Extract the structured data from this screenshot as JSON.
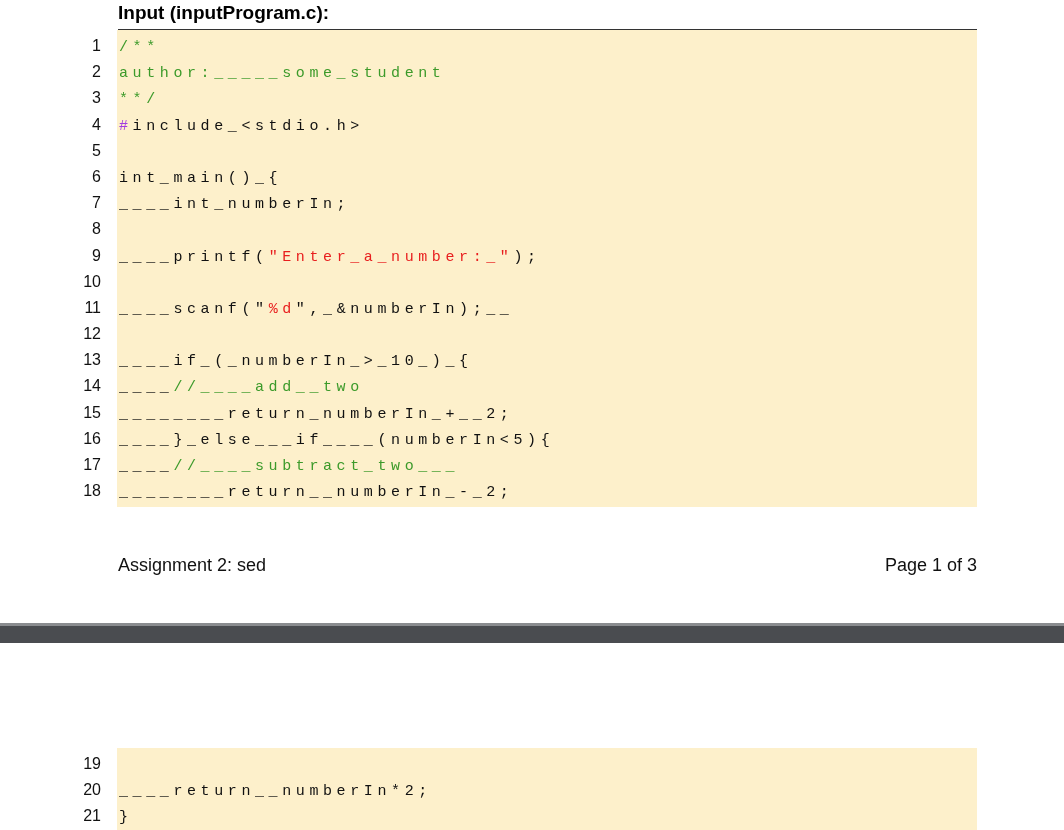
{
  "pages": [
    {
      "heading": "Input (inputProgram.c):",
      "code_lines": [
        {
          "number": "1",
          "segments": [
            {
              "kind": "comment",
              "text": "/**"
            }
          ]
        },
        {
          "number": "2",
          "segments": [
            {
              "kind": "comment",
              "text": "author:_____some_student"
            }
          ]
        },
        {
          "number": "3",
          "segments": [
            {
              "kind": "comment",
              "text": "**/"
            }
          ]
        },
        {
          "number": "4",
          "segments": [
            {
              "kind": "preproc",
              "text": "#"
            },
            {
              "kind": "plain",
              "text": "include_<stdio.h>"
            }
          ]
        },
        {
          "number": "5"
        },
        {
          "number": "6",
          "segments": [
            {
              "kind": "plain",
              "text": "int_main()_{"
            }
          ]
        },
        {
          "number": "7",
          "segments": [
            {
              "kind": "plain",
              "text": "____int_numberIn;"
            }
          ]
        },
        {
          "number": "8"
        },
        {
          "number": "9",
          "segments": [
            {
              "kind": "plain",
              "text": "____printf("
            },
            {
              "kind": "string",
              "text": "\"Enter_a_number:_\""
            },
            {
              "kind": "plain",
              "text": ");"
            }
          ]
        },
        {
          "number": "10"
        },
        {
          "number": "11",
          "segments": [
            {
              "kind": "plain",
              "text": "____scanf(\""
            },
            {
              "kind": "string",
              "text": "%d"
            },
            {
              "kind": "plain",
              "text": "\",_&numberIn);__"
            }
          ]
        },
        {
          "number": "12"
        },
        {
          "number": "13",
          "segments": [
            {
              "kind": "plain",
              "text": "____if_(_numberIn_>_10_)_{"
            }
          ]
        },
        {
          "number": "14",
          "segments": [
            {
              "kind": "plain",
              "text": "____"
            },
            {
              "kind": "comment",
              "text": "//____add__two"
            }
          ]
        },
        {
          "number": "15",
          "segments": [
            {
              "kind": "plain",
              "text": "________return_numberIn_+__2;"
            }
          ]
        },
        {
          "number": "16",
          "segments": [
            {
              "kind": "plain",
              "text": "____}_else___if____(numberIn<5){"
            }
          ]
        },
        {
          "number": "17",
          "segments": [
            {
              "kind": "plain",
              "text": "____"
            },
            {
              "kind": "comment",
              "text": "//____subtract_two___"
            }
          ]
        },
        {
          "number": "18",
          "segments": [
            {
              "kind": "plain",
              "text": "________return__numberIn_-_2;"
            }
          ]
        }
      ],
      "footer": {
        "left": "Assignment 2: sed",
        "right": "Page 1 of 3"
      }
    },
    {
      "code_lines": [
        {
          "number": "19"
        },
        {
          "number": "20",
          "segments": [
            {
              "kind": "plain",
              "text": "____return__numberIn*2;"
            }
          ]
        },
        {
          "number": "21",
          "segments": [
            {
              "kind": "plain",
              "text": "}"
            }
          ]
        }
      ]
    }
  ]
}
